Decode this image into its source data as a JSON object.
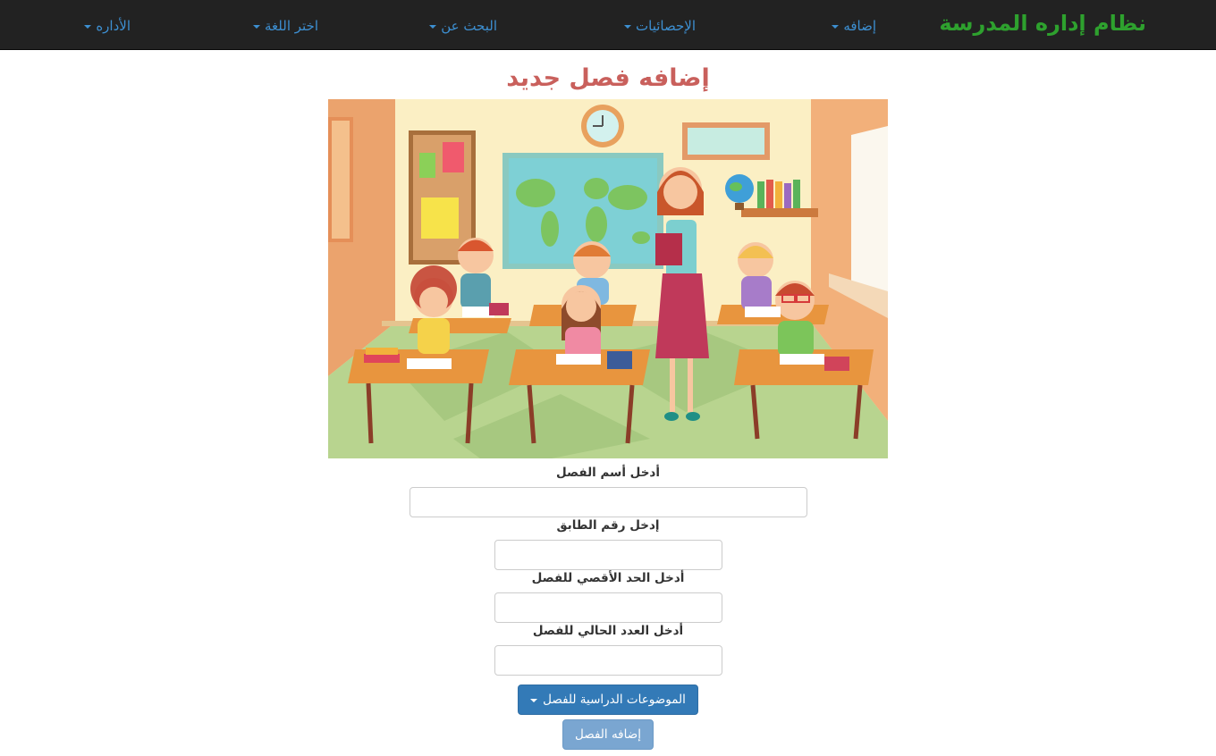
{
  "navbar": {
    "brand": "نظام إداره المدرسة",
    "items": [
      {
        "label": "إضافه"
      },
      {
        "label": "الإحصائيات"
      },
      {
        "label": "البحث عن"
      },
      {
        "label": "اختر اللغة"
      },
      {
        "label": "الأداره"
      }
    ]
  },
  "page": {
    "title": "إضافه فصل جديد"
  },
  "form": {
    "fields": [
      {
        "label": "أدخل أسم الفصل",
        "value": ""
      },
      {
        "label": "إدخل رقم الطابق",
        "value": ""
      },
      {
        "label": "أدخل الحد الأقصي للفصل",
        "value": ""
      },
      {
        "label": "أدخل العدد الحالي للفصل",
        "value": ""
      }
    ],
    "subjects_button": "الموضوعات الدراسية للفصل",
    "submit_button": "إضافه الفصل"
  },
  "colors": {
    "navbar_bg": "#222222",
    "brand": "#2ea12e",
    "nav_link": "#3d8fd1",
    "title": "#c9605c",
    "primary_button": "#337ab7",
    "disabled_button": "#7aa6d1"
  }
}
